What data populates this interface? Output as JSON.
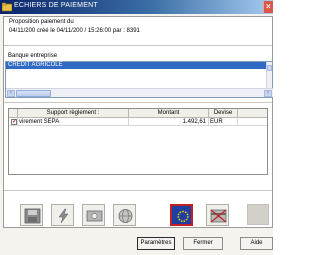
{
  "window": {
    "title": "ECHIERS DE PAIEMENT",
    "app_icon": "folder-icon",
    "close_icon": "close-icon"
  },
  "info": {
    "line1": "Proposition paiement du",
    "line2": "04/11/200  créé le    04/11/200  / 15:26:00  par :       8391"
  },
  "bank": {
    "label": "Banque entreprise",
    "selected": "CREDIT AGRICOLE"
  },
  "grid": {
    "columns": [
      "",
      "Support règlement :",
      "Montant",
      "Devise"
    ],
    "rows": [
      {
        "checked": "✓",
        "support": "virement SEPA",
        "montant": "1.492,61",
        "devise": "EUR"
      }
    ]
  },
  "toolbar": {
    "icons": [
      "save-icon",
      "lightning-icon",
      "money-icon",
      "globe-icon",
      "eu-flag-icon",
      "crossed-card-icon",
      "blank-icon"
    ],
    "active_index": 4
  },
  "buttons": {
    "params": "Paramètres",
    "fermer": "Fermer",
    "aide": "Aide"
  },
  "colors": {
    "titlebar": "#0a246a",
    "selection": "#316ac5",
    "active_border": "#c02020"
  }
}
